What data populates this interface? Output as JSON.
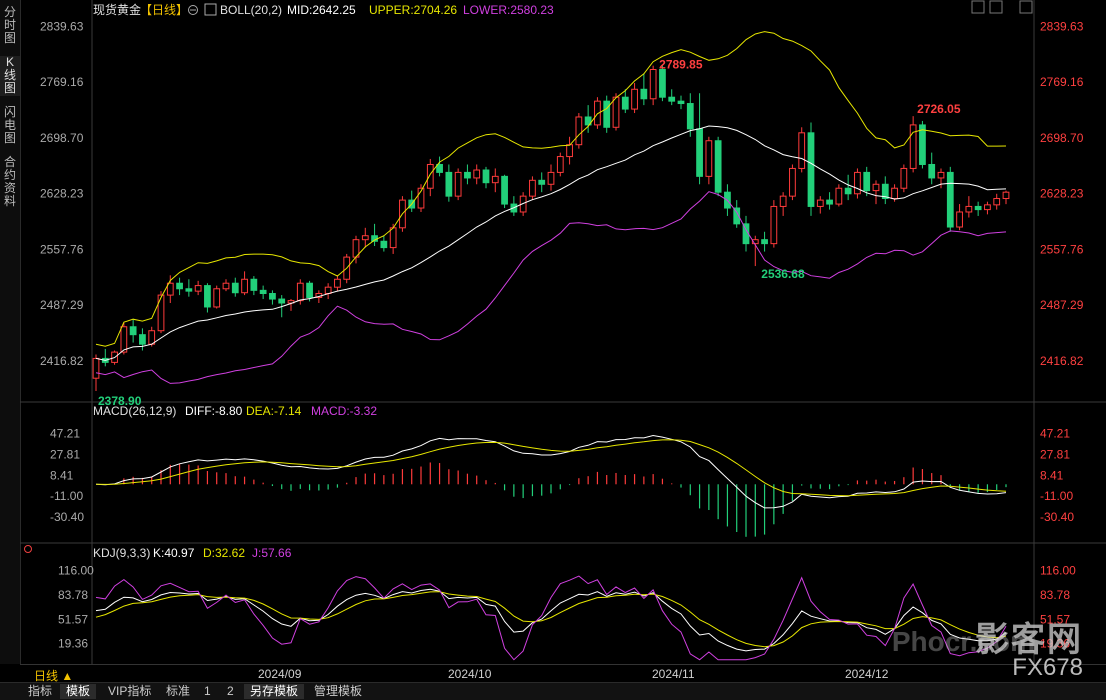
{
  "side_tabs": [
    {
      "label": "分时图"
    },
    {
      "label": "K线图"
    },
    {
      "label": "闪电图"
    },
    {
      "label": "合约资料"
    }
  ],
  "main_panel": {
    "title": "现货黄金",
    "period_tag": "【日线】",
    "boll_label": "BOLL(20,2)",
    "mid": "MID:2642.25",
    "upper": "UPPER:2704.26",
    "lower": "LOWER:2580.23",
    "annotations": {
      "high": "2789.85",
      "high2": "2726.05",
      "low": "2536.68",
      "low0": "2378.90"
    }
  },
  "macd_panel": {
    "label": "MACD(26,12,9)",
    "diff": "DIFF:-8.80",
    "dea": "DEA:-7.14",
    "macd": "MACD:-3.32"
  },
  "kdj_panel": {
    "label": "KDJ(9,3,3)",
    "k": "K:40.97",
    "d": "D:32.62",
    "j": "J:57.66"
  },
  "x_axis": {
    "ticks": [
      "2024/09",
      "2024/10",
      "2024/11",
      "2024/12"
    ]
  },
  "period_label": "日线 ▲",
  "bottom_tabs": [
    "指标",
    "模板",
    "VIP指标",
    "标准",
    "1",
    "2",
    "另存模板",
    "管理模板"
  ],
  "watermark": {
    "brand": "影客网",
    "url": "Phocr.com",
    "code": "FX678"
  },
  "colors": {
    "up": "#ff3b3b",
    "down": "#22d07a",
    "mid": "#ffffff",
    "upper": "#e6e600",
    "lower": "#d040e0",
    "price_axis": "#ff4040",
    "label_cyan": "#cfcfcf"
  },
  "chart_data": [
    {
      "type": "candlestick",
      "name": "现货黄金 日线",
      "y_ticks": [
        2839.63,
        2769.16,
        2698.7,
        2628.23,
        2557.76,
        2487.29,
        2416.82
      ],
      "ylim": [
        2370,
        2845
      ],
      "candles": [
        [
          2395,
          2425,
          2378.9,
          2420
        ],
        [
          2420,
          2432,
          2410,
          2415
        ],
        [
          2415,
          2430,
          2412,
          2428
        ],
        [
          2428,
          2465,
          2425,
          2460
        ],
        [
          2460,
          2470,
          2440,
          2450
        ],
        [
          2450,
          2458,
          2430,
          2438
        ],
        [
          2438,
          2460,
          2435,
          2455
        ],
        [
          2455,
          2505,
          2452,
          2500
        ],
        [
          2500,
          2525,
          2490,
          2515
        ],
        [
          2515,
          2522,
          2500,
          2508
        ],
        [
          2508,
          2520,
          2498,
          2505
        ],
        [
          2505,
          2518,
          2500,
          2512
        ],
        [
          2512,
          2515,
          2478,
          2485
        ],
        [
          2485,
          2512,
          2483,
          2508
        ],
        [
          2508,
          2520,
          2505,
          2515
        ],
        [
          2515,
          2522,
          2498,
          2503
        ],
        [
          2503,
          2530,
          2500,
          2520
        ],
        [
          2520,
          2524,
          2500,
          2506
        ],
        [
          2506,
          2512,
          2495,
          2502
        ],
        [
          2502,
          2506,
          2488,
          2495
        ],
        [
          2495,
          2500,
          2472,
          2490
        ],
        [
          2490,
          2495,
          2480,
          2493
        ],
        [
          2493,
          2520,
          2488,
          2515
        ],
        [
          2515,
          2518,
          2492,
          2497
        ],
        [
          2497,
          2506,
          2490,
          2502
        ],
        [
          2502,
          2515,
          2495,
          2510
        ],
        [
          2510,
          2525,
          2505,
          2520
        ],
        [
          2520,
          2552,
          2515,
          2548
        ],
        [
          2548,
          2575,
          2540,
          2570
        ],
        [
          2570,
          2585,
          2560,
          2575
        ],
        [
          2575,
          2590,
          2562,
          2568
        ],
        [
          2568,
          2575,
          2555,
          2560
        ],
        [
          2560,
          2590,
          2552,
          2585
        ],
        [
          2585,
          2625,
          2580,
          2620
        ],
        [
          2620,
          2632,
          2605,
          2610
        ],
        [
          2610,
          2640,
          2605,
          2635
        ],
        [
          2635,
          2672,
          2625,
          2665
        ],
        [
          2665,
          2675,
          2650,
          2655
        ],
        [
          2655,
          2665,
          2618,
          2625
        ],
        [
          2625,
          2660,
          2620,
          2655
        ],
        [
          2655,
          2665,
          2640,
          2648
        ],
        [
          2648,
          2665,
          2640,
          2658
        ],
        [
          2658,
          2662,
          2635,
          2642
        ],
        [
          2642,
          2660,
          2630,
          2650
        ],
        [
          2650,
          2652,
          2610,
          2615
        ],
        [
          2615,
          2625,
          2600,
          2605
        ],
        [
          2605,
          2630,
          2600,
          2625
        ],
        [
          2625,
          2650,
          2620,
          2645
        ],
        [
          2645,
          2655,
          2630,
          2640
        ],
        [
          2640,
          2665,
          2632,
          2655
        ],
        [
          2655,
          2680,
          2650,
          2675
        ],
        [
          2675,
          2700,
          2665,
          2690
        ],
        [
          2690,
          2730,
          2685,
          2725
        ],
        [
          2725,
          2740,
          2705,
          2715
        ],
        [
          2715,
          2750,
          2710,
          2745
        ],
        [
          2745,
          2752,
          2705,
          2712
        ],
        [
          2712,
          2755,
          2708,
          2750
        ],
        [
          2750,
          2760,
          2730,
          2735
        ],
        [
          2735,
          2768,
          2730,
          2760
        ],
        [
          2760,
          2780,
          2740,
          2748
        ],
        [
          2748,
          2789.85,
          2740,
          2785
        ],
        [
          2785,
          2790,
          2745,
          2750
        ],
        [
          2750,
          2760,
          2740,
          2745
        ],
        [
          2745,
          2752,
          2735,
          2742
        ],
        [
          2742,
          2755,
          2700,
          2710
        ],
        [
          2710,
          2755,
          2640,
          2650
        ],
        [
          2650,
          2700,
          2640,
          2695
        ],
        [
          2695,
          2700,
          2625,
          2630
        ],
        [
          2630,
          2640,
          2600,
          2610
        ],
        [
          2610,
          2620,
          2585,
          2590
        ],
        [
          2590,
          2600,
          2555,
          2565
        ],
        [
          2565,
          2575,
          2536.68,
          2570
        ],
        [
          2570,
          2580,
          2555,
          2565
        ],
        [
          2565,
          2620,
          2560,
          2612
        ],
        [
          2612,
          2630,
          2600,
          2625
        ],
        [
          2625,
          2665,
          2620,
          2660
        ],
        [
          2660,
          2712,
          2655,
          2705
        ],
        [
          2705,
          2718,
          2600,
          2612
        ],
        [
          2612,
          2625,
          2603,
          2620
        ],
        [
          2620,
          2630,
          2608,
          2615
        ],
        [
          2615,
          2640,
          2612,
          2635
        ],
        [
          2635,
          2652,
          2620,
          2628
        ],
        [
          2628,
          2660,
          2622,
          2655
        ],
        [
          2655,
          2662,
          2625,
          2632
        ],
        [
          2632,
          2645,
          2615,
          2640
        ],
        [
          2640,
          2650,
          2615,
          2622
        ],
        [
          2622,
          2640,
          2618,
          2635
        ],
        [
          2635,
          2665,
          2630,
          2660
        ],
        [
          2660,
          2726.05,
          2655,
          2715
        ],
        [
          2715,
          2720,
          2660,
          2665
        ],
        [
          2665,
          2680,
          2640,
          2648
        ],
        [
          2648,
          2660,
          2635,
          2655
        ],
        [
          2655,
          2662,
          2580,
          2586
        ],
        [
          2586,
          2615,
          2582,
          2605
        ],
        [
          2605,
          2625,
          2598,
          2612
        ],
        [
          2612,
          2618,
          2600,
          2608
        ],
        [
          2608,
          2618,
          2602,
          2614
        ],
        [
          2614,
          2628,
          2608,
          2622
        ],
        [
          2622,
          2632,
          2615,
          2630
        ]
      ]
    },
    {
      "type": "bar+line",
      "name": "MACD",
      "y_ticks": [
        47.21,
        27.81,
        8.41,
        -11.0,
        -30.4
      ],
      "ylim": [
        -52,
        60
      ]
    },
    {
      "type": "line",
      "name": "KDJ",
      "y_ticks": [
        116.0,
        83.78,
        51.57,
        19.36
      ],
      "ylim": [
        -5,
        130
      ]
    }
  ]
}
